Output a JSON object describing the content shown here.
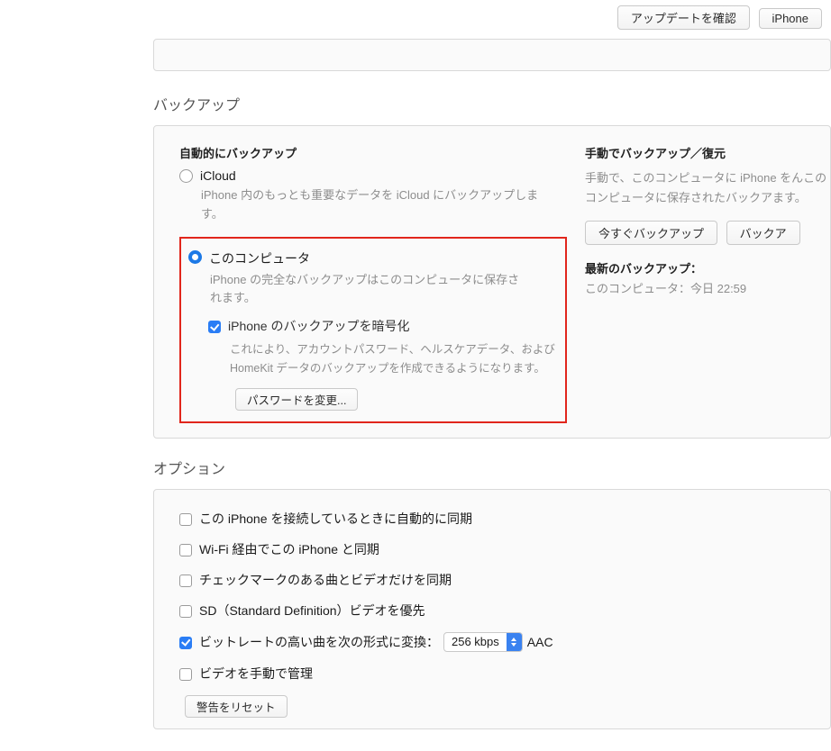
{
  "top_buttons": {
    "check_update": "アップデートを確認",
    "iphone": "iPhone"
  },
  "backup": {
    "title": "バックアップ",
    "auto": {
      "heading": "自動的にバックアップ",
      "icloud": {
        "label": "iCloud",
        "desc": "iPhone 内のもっとも重要なデータを iCloud にバックアップします。"
      },
      "computer": {
        "label": "このコンピュータ",
        "desc": "iPhone の完全なバックアップはこのコンピュータに保存されます。"
      },
      "encrypt": {
        "label": "iPhone のバックアップを暗号化",
        "desc": "これにより、アカウントパスワード、ヘルスケアデータ、および HomeKit データのバックアップを作成できるようになります。",
        "change_pw": "パスワードを変更..."
      }
    },
    "manual": {
      "heading": "手動でバックアップ／復元",
      "desc": "手動で、このコンピュータに iPhone をんこのコンピュータに保存されたバックアます。",
      "backup_now": "今すぐバックアップ",
      "restore": "バックア",
      "latest_label": "最新のバックアップ：",
      "latest_value": "このコンピュータ：今日 22:59"
    }
  },
  "options": {
    "title": "オプション",
    "items": {
      "auto_sync": "この iPhone を接続しているときに自動的に同期",
      "wifi_sync": "Wi-Fi 経由でこの iPhone と同期",
      "checked_only": "チェックマークのある曲とビデオだけを同期",
      "sd_video": "SD（Standard Definition）ビデオを優先",
      "bitrate_prefix": "ビットレートの高い曲を次の形式に変換：",
      "bitrate_value": "256 kbps",
      "bitrate_suffix": "AAC",
      "manual_video": "ビデオを手動で管理"
    },
    "reset_warnings": "警告をリセット"
  }
}
